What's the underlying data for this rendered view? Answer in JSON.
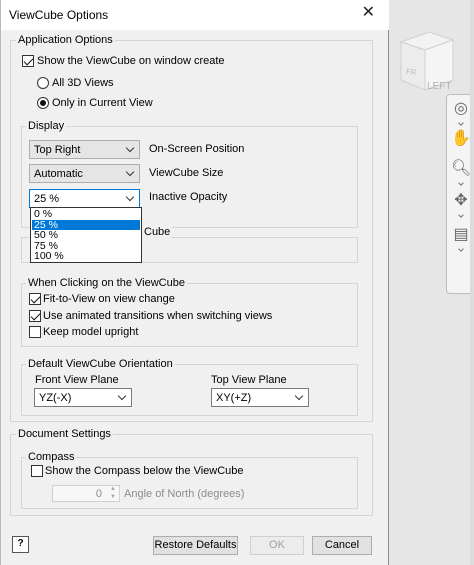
{
  "window": {
    "title": "ViewCube Options",
    "close_glyph": "✕"
  },
  "viewcube_face": "LEFT",
  "application_options": {
    "legend": "Application Options",
    "show_on_create": {
      "label": "Show the ViewCube on window create",
      "checked": true
    },
    "all_3d_views": {
      "label": "All 3D Views",
      "selected": false
    },
    "only_current": {
      "label": "Only in Current View",
      "selected": true
    }
  },
  "display": {
    "legend": "Display",
    "position": {
      "value": "Top Right",
      "label": "On-Screen Position"
    },
    "size": {
      "value": "Automatic",
      "label": "ViewCube Size"
    },
    "opacity": {
      "value": "25 %",
      "label": "Inactive Opacity",
      "options": [
        "0 %",
        "25 %",
        "50 %",
        "75 %",
        "100 %"
      ],
      "selected_index": 1
    },
    "hidden_legend_fragment": "Cube"
  },
  "clicking": {
    "legend": "When Clicking on the ViewCube",
    "fit_to_view": {
      "label": "Fit-to-View on view change",
      "checked": true
    },
    "animated": {
      "label": "Use animated transitions when switching views",
      "checked": true
    },
    "keep_upright": {
      "label": "Keep model upright",
      "checked": false
    }
  },
  "orientation": {
    "legend": "Default ViewCube Orientation",
    "front_label": "Front View Plane",
    "front_value": "YZ(-X)",
    "top_label": "Top View Plane",
    "top_value": "XY(+Z)"
  },
  "document_settings": {
    "legend": "Document Settings",
    "compass_legend": "Compass",
    "show_compass": {
      "label": "Show the Compass below the ViewCube",
      "checked": false
    },
    "angle_value": "0",
    "angle_label": "Angle of North (degrees)"
  },
  "buttons": {
    "help": "?",
    "restore": "Restore Defaults",
    "ok": "OK",
    "cancel": "Cancel"
  }
}
